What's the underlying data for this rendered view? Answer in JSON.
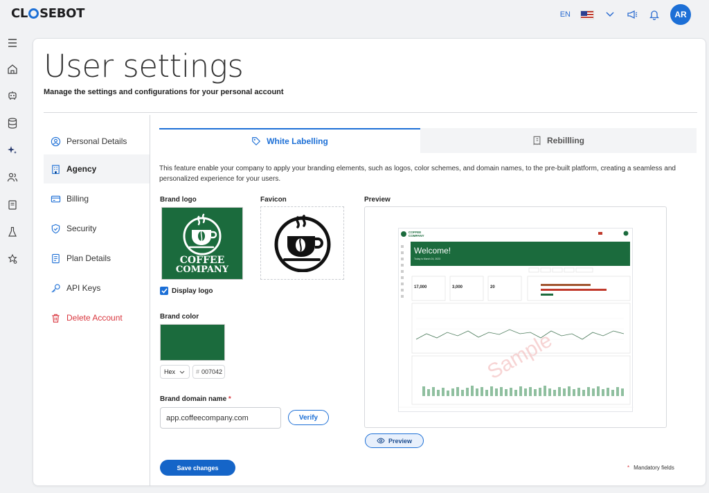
{
  "app": {
    "logo_text_a": "CL",
    "logo_text_b": "SEBOT",
    "language": "EN",
    "avatar_initials": "AR"
  },
  "rail_icons": [
    "menu-icon",
    "home-icon",
    "bot-icon",
    "database-icon",
    "sparkles-icon",
    "users-icon",
    "book-icon",
    "flask-icon",
    "star-search-icon"
  ],
  "page": {
    "title": "User settings",
    "subtitle": "Manage the settings and configurations for your personal account"
  },
  "sidebar": {
    "items": [
      {
        "label": "Personal Details",
        "icon": "user-circle-icon"
      },
      {
        "label": "Agency",
        "icon": "building-icon"
      },
      {
        "label": "Billing",
        "icon": "credit-card-icon"
      },
      {
        "label": "Security",
        "icon": "shield-icon"
      },
      {
        "label": "Plan Details",
        "icon": "document-icon"
      },
      {
        "label": "API Keys",
        "icon": "key-icon"
      },
      {
        "label": "Delete Account",
        "icon": "trash-icon"
      }
    ],
    "active_index": 1
  },
  "tabs": {
    "white_labelling": "White Labelling",
    "rebilling": "Rebillling"
  },
  "description": "This feature enable your company to apply your branding elements, such as logos, color schemes, and domain names, to the pre-built platform, creating a seamless and personalized experience for your users.",
  "brand": {
    "logo_label": "Brand logo",
    "logo_text_1": "COFFEE",
    "logo_text_2": "COMPANY",
    "favicon_label": "Favicon",
    "display_logo_label": "Display logo",
    "display_logo_checked": true,
    "color_label": "Brand color",
    "color_format": "Hex",
    "color_hash": "#",
    "color_value": "007042",
    "color_swatch": "#1b6b3d",
    "domain_label": "Brand domain name",
    "domain_required_mark": "*",
    "domain_value": "app.coffeecompany.com",
    "verify_label": "Verify"
  },
  "preview": {
    "label": "Preview",
    "button_label": "Preview",
    "mini_brand_1": "COFFEE",
    "mini_brand_2": "COMPANY",
    "mini_welcome": "Welcome!",
    "mini_date": "Today is March 24, 2023",
    "mini_stats": [
      "17,000",
      "3,000",
      "20"
    ],
    "watermark": "Sample"
  },
  "footer": {
    "save_label": "Save changes",
    "mandatory_mark": "*",
    "mandatory_label": "Mandatory fields"
  },
  "colors": {
    "accent": "#1c6fd6",
    "brand_green": "#1b6b3d",
    "danger": "#d9363e"
  }
}
